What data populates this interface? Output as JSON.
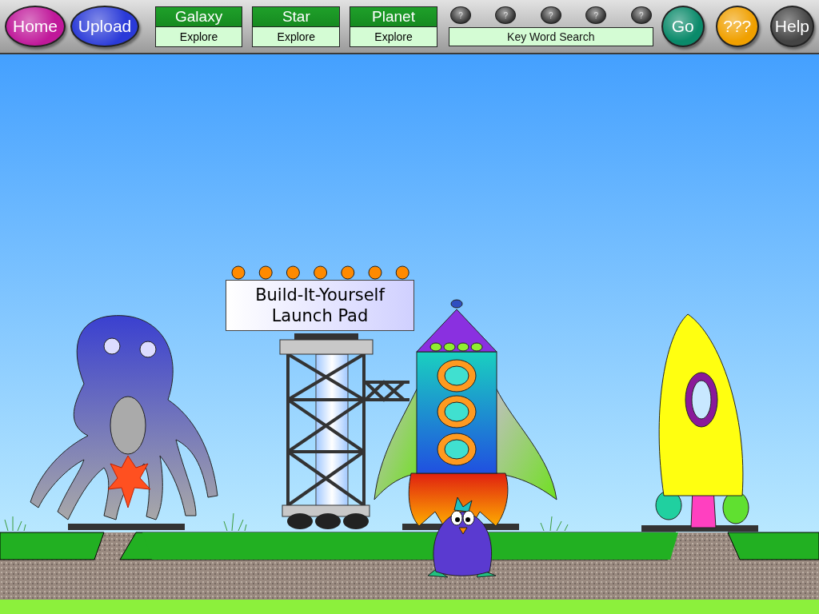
{
  "toolbar": {
    "left_buttons": [
      {
        "label": "Home",
        "color": "#c0189a"
      },
      {
        "label": "Upload",
        "color": "#2a3ad8"
      }
    ],
    "categories": [
      {
        "title": "Galaxy",
        "action": "Explore"
      },
      {
        "title": "Star",
        "action": "Explore"
      },
      {
        "title": "Planet",
        "action": "Explore"
      }
    ],
    "hint_buttons": [
      "?",
      "?",
      "?",
      "?",
      "?"
    ],
    "search": {
      "placeholder": "Key Word Search"
    },
    "right_buttons": [
      {
        "label": "Go",
        "color": "#0a8a6a"
      },
      {
        "label": "???",
        "color": "#f0a000"
      },
      {
        "label": "Help",
        "color": "#444444"
      }
    ]
  },
  "scene": {
    "sign": {
      "lines": [
        "Build-It-Yourself",
        "Launch Pad"
      ]
    }
  }
}
